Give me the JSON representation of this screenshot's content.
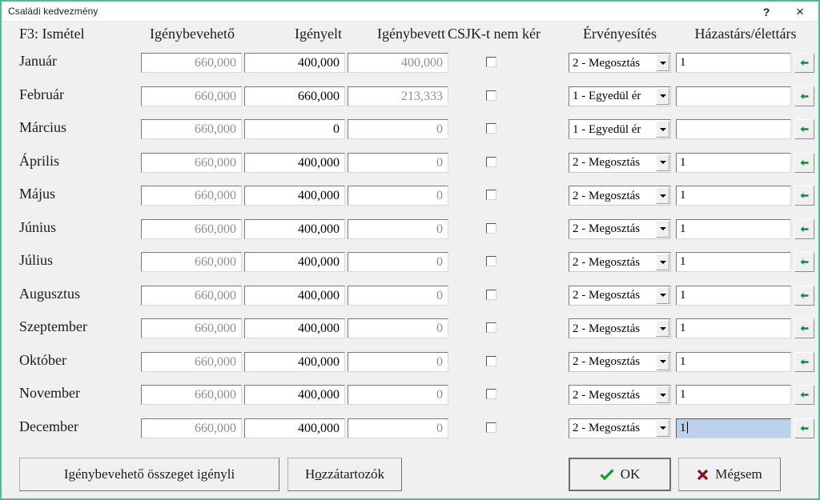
{
  "window": {
    "title": "Családi kedvezmény",
    "help_label": "?",
    "close_label": "×",
    "accent_color": "#4bbd8e",
    "body_color": "#f0f0f0"
  },
  "headers": {
    "repeat_hint": "F3: Ismétel",
    "igenybeveheto": "Igénybevehető",
    "igenyelt": "Igényelt",
    "igenybevett": "Igénybevett",
    "csjk": "CSJK-t nem kér",
    "ervenyesites": "Érvényesítés",
    "hazastars": "Házastárs/élettárs"
  },
  "rows": [
    {
      "month": "Január",
      "igenybeveheto": "660,000",
      "igenyelt": "400,000",
      "igenybevett": "400,000",
      "csjk_checked": false,
      "ervenyesites": "2 - Megosztás",
      "hazastars": "1",
      "focused": false
    },
    {
      "month": "Február",
      "igenybeveheto": "660,000",
      "igenyelt": "660,000",
      "igenybevett": "213,333",
      "csjk_checked": false,
      "ervenyesites": "1 - Egyedül ér",
      "hazastars": "",
      "focused": false
    },
    {
      "month": "Március",
      "igenybeveheto": "660,000",
      "igenyelt": "0",
      "igenybevett": "0",
      "csjk_checked": false,
      "ervenyesites": "1 - Egyedül ér",
      "hazastars": "",
      "focused": false
    },
    {
      "month": "Április",
      "igenybeveheto": "660,000",
      "igenyelt": "400,000",
      "igenybevett": "0",
      "csjk_checked": false,
      "ervenyesites": "2 - Megosztás",
      "hazastars": "1",
      "focused": false
    },
    {
      "month": "Május",
      "igenybeveheto": "660,000",
      "igenyelt": "400,000",
      "igenybevett": "0",
      "csjk_checked": false,
      "ervenyesites": "2 - Megosztás",
      "hazastars": "1",
      "focused": false
    },
    {
      "month": "Június",
      "igenybeveheto": "660,000",
      "igenyelt": "400,000",
      "igenybevett": "0",
      "csjk_checked": false,
      "ervenyesites": "2 - Megosztás",
      "hazastars": "1",
      "focused": false
    },
    {
      "month": "Július",
      "igenybeveheto": "660,000",
      "igenyelt": "400,000",
      "igenybevett": "0",
      "csjk_checked": false,
      "ervenyesites": "2 - Megosztás",
      "hazastars": "1",
      "focused": false
    },
    {
      "month": "Augusztus",
      "igenybeveheto": "660,000",
      "igenyelt": "400,000",
      "igenybevett": "0",
      "csjk_checked": false,
      "ervenyesites": "2 - Megosztás",
      "hazastars": "1",
      "focused": false
    },
    {
      "month": "Szeptember",
      "igenybeveheto": "660,000",
      "igenyelt": "400,000",
      "igenybevett": "0",
      "csjk_checked": false,
      "ervenyesites": "2 - Megosztás",
      "hazastars": "1",
      "focused": false
    },
    {
      "month": "Október",
      "igenybeveheto": "660,000",
      "igenyelt": "400,000",
      "igenybevett": "0",
      "csjk_checked": false,
      "ervenyesites": "2 - Megosztás",
      "hazastars": "1",
      "focused": false
    },
    {
      "month": "November",
      "igenybeveheto": "660,000",
      "igenyelt": "400,000",
      "igenybevett": "0",
      "csjk_checked": false,
      "ervenyesites": "2 - Megosztás",
      "hazastars": "1",
      "focused": false
    },
    {
      "month": "December",
      "igenybeveheto": "660,000",
      "igenyelt": "400,000",
      "igenybevett": "0",
      "csjk_checked": false,
      "ervenyesites": "2 - Megosztás",
      "hazastars": "1",
      "focused": true
    }
  ],
  "row_icons": {
    "spouse_picker": "green-left-arrow-icon",
    "combo_toggle": "chevron-down-icon",
    "checkbox": "checkbox-icon"
  },
  "footer": {
    "claim_available_label": "Igénybevehető összeget igényli",
    "dependents_label_pre": "H",
    "dependents_label_accel": "o",
    "dependents_label_post": "zzátartozók",
    "ok_label": "OK",
    "cancel_label": "Mégsem",
    "ok_icon": "check-icon",
    "cancel_icon": "cross-icon",
    "ok_icon_color": "#1a9b28",
    "cancel_icon_color": "#8b0d1a"
  }
}
